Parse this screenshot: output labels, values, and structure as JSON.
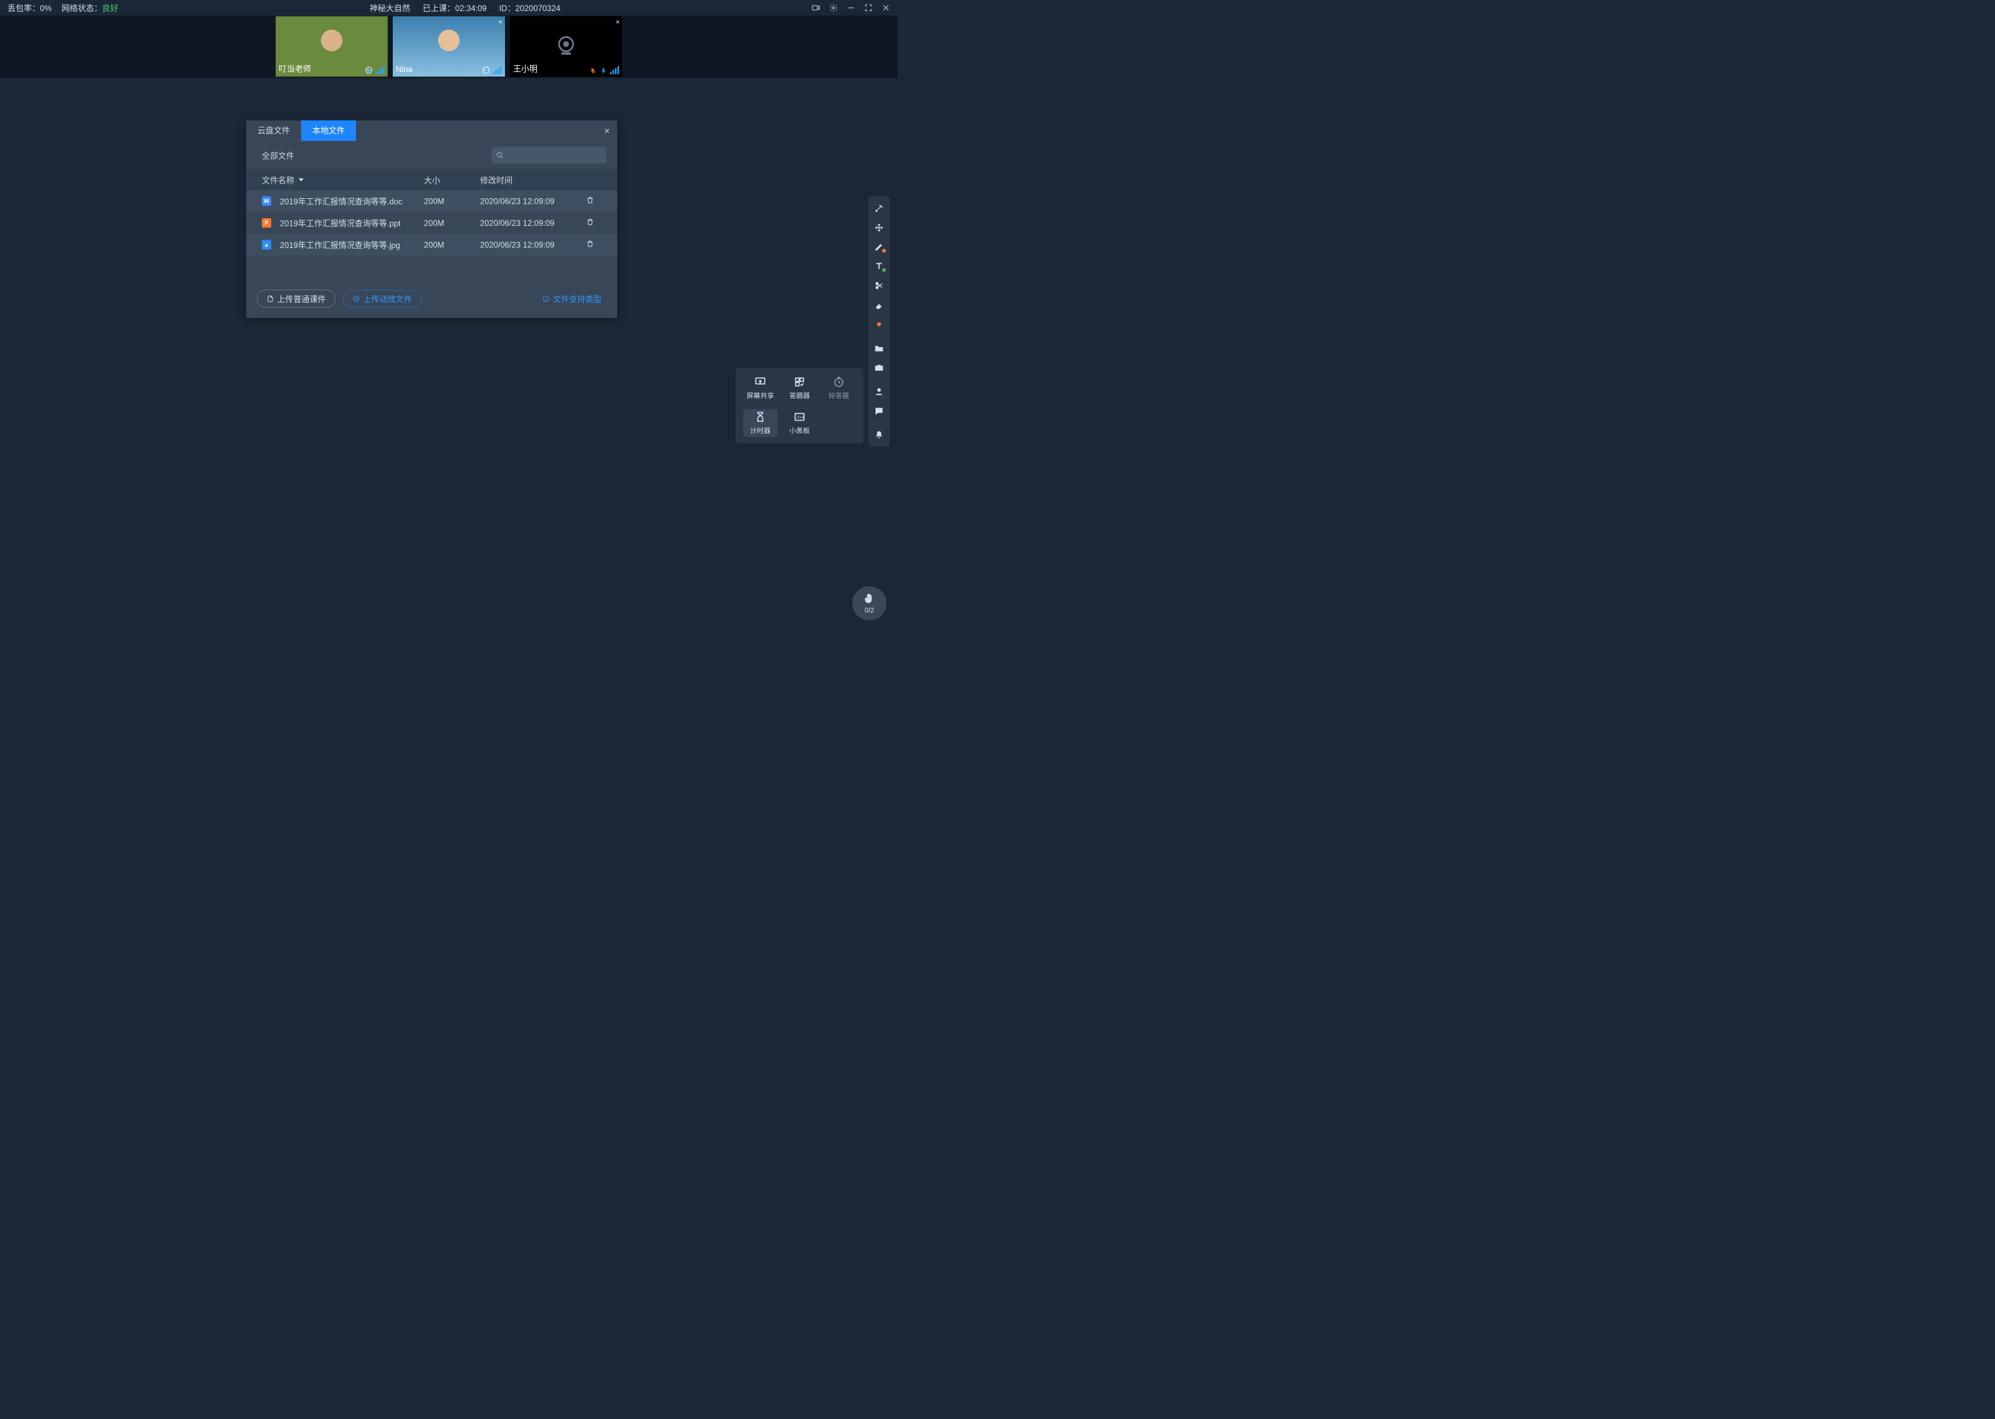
{
  "topbar": {
    "loss_label": "丢包率：",
    "loss_value": "0%",
    "net_label": "网络状态：",
    "net_value": "良好",
    "title": "神秘大自然",
    "elapsed_label": "已上课：",
    "elapsed_value": "02:34:09",
    "id_label": "ID：",
    "id_value": "2020070324"
  },
  "videos": [
    {
      "name": "叮当老师",
      "camera": "on",
      "closable": false,
      "muted": false
    },
    {
      "name": "Nina",
      "camera": "on",
      "closable": true,
      "muted": false
    },
    {
      "name": "王小明",
      "camera": "off",
      "closable": true,
      "muted": true
    }
  ],
  "dialog": {
    "tab_cloud": "云盘文件",
    "tab_local": "本地文件",
    "active_tab": "local",
    "filter_label": "全部文件",
    "col_name": "文件名称",
    "col_size": "大小",
    "col_date": "修改时间",
    "rows": [
      {
        "type": "doc",
        "name": "2019年工作汇报情况查询等等.doc",
        "size": "200M",
        "date": "2020/06/23 12:09:09"
      },
      {
        "type": "ppt",
        "name": "2019年工作汇报情况查询等等.ppt",
        "size": "200M",
        "date": "2020/06/23 12:09:09"
      },
      {
        "type": "jpg",
        "name": "2019年工作汇报情况查询等等.jpg",
        "size": "200M",
        "date": "2020/06/23 12:09:09"
      }
    ],
    "btn_upload_normal": "上传普通课件",
    "btn_upload_anim": "上传动效文件",
    "supported_types": "文件支持类型"
  },
  "popup": {
    "items": [
      {
        "key": "screen-share",
        "label": "屏幕共享"
      },
      {
        "key": "answer-tool",
        "label": "答题器"
      },
      {
        "key": "race-answer",
        "label": "抢答器",
        "dim": true
      },
      {
        "key": "timer",
        "label": "计时器",
        "selected": true
      },
      {
        "key": "mini-board",
        "label": "小黑板"
      }
    ]
  },
  "hand_badge": "0/2",
  "toolbar_icons": [
    "laser",
    "move",
    "pen",
    "text",
    "scissors",
    "eraser",
    "dot-style",
    "SEP",
    "folder",
    "toolbox",
    "SEP",
    "person",
    "chat",
    "SEP",
    "bell"
  ]
}
